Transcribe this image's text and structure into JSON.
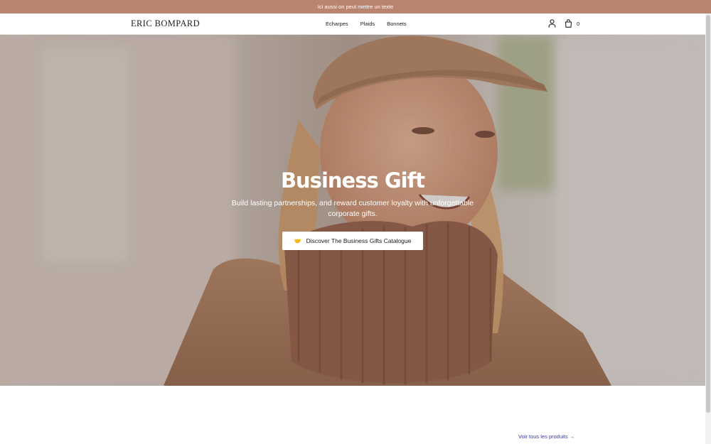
{
  "announcement": {
    "text": "Ici aussi on peut mettre un texte"
  },
  "header": {
    "logo": "ERIC BOMPARD",
    "nav": [
      {
        "label": "Echarpes"
      },
      {
        "label": "Plaids"
      },
      {
        "label": "Bonnets"
      }
    ],
    "account_icon": "user-icon",
    "cart_icon": "shopping-bag-icon",
    "cart_count": "0"
  },
  "hero": {
    "title": "Business Gift",
    "subtitle": "Build lasting partnerships, and reward customer loyalty with unforgettable corporate gifts.",
    "button_emoji": "🤝",
    "button_label": "Discover The Business Gifts Catalogue",
    "image": "woman-in-camel-cap-and-knit-scarf"
  },
  "products": {
    "view_all_label": "Voir tous les produits →"
  },
  "colors": {
    "announcement_bg": "#b98570",
    "link": "#3b3bb5"
  }
}
